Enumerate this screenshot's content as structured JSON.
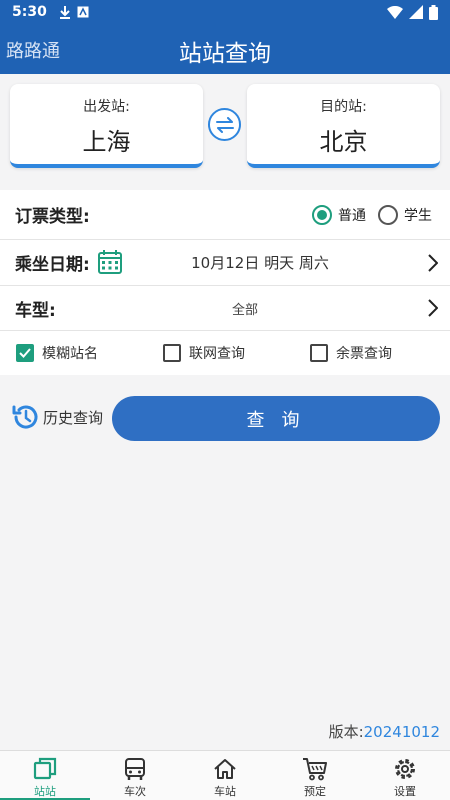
{
  "status_bar": {
    "time": "5:30"
  },
  "app_bar": {
    "app_name": "路路通",
    "title": "站站查询"
  },
  "stations": {
    "from_label": "出发站:",
    "from_value": "上海",
    "to_label": "目的站:",
    "to_value": "北京"
  },
  "ticket_type": {
    "label": "订票类型:",
    "options": [
      {
        "label": "普通",
        "checked": true
      },
      {
        "label": "学生",
        "checked": false
      }
    ]
  },
  "date": {
    "label": "乘坐日期:",
    "value": "10月12日 明天 周六"
  },
  "train_type": {
    "label": "车型:",
    "value": "全部"
  },
  "options": {
    "fuzzy": {
      "label": "模糊站名",
      "checked": true
    },
    "online": {
      "label": "联网查询",
      "checked": false
    },
    "remaining": {
      "label": "余票查询",
      "checked": false
    }
  },
  "actions": {
    "history_label": "历史查询",
    "query_label": "查 询"
  },
  "version": {
    "label": "版本:",
    "number": "20241012"
  },
  "bottom_nav": {
    "items": [
      {
        "label": "站站",
        "icon": "station-to-station-icon",
        "active": true
      },
      {
        "label": "车次",
        "icon": "bus-icon",
        "active": false
      },
      {
        "label": "车站",
        "icon": "home-icon",
        "active": false
      },
      {
        "label": "预定",
        "icon": "cart-icon",
        "active": false
      },
      {
        "label": "设置",
        "icon": "gear-icon",
        "active": false
      }
    ]
  },
  "colors": {
    "primary": "#1f62b4",
    "accent": "#1e9e7e",
    "button": "#2f6fc3",
    "link": "#2f86de"
  }
}
